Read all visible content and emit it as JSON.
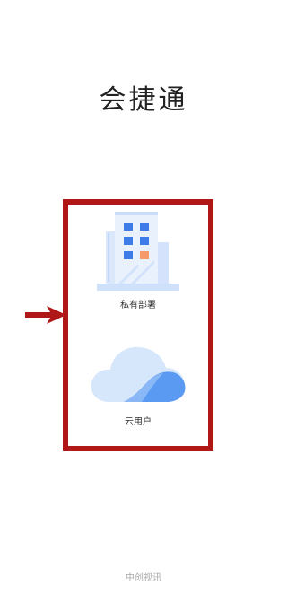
{
  "app": {
    "title": "会捷通"
  },
  "options": {
    "private": {
      "label": "私有部署",
      "icon": "office-building-icon"
    },
    "cloud": {
      "label": "云用户",
      "icon": "cloud-icon"
    }
  },
  "annotation": {
    "arrow_icon": "red-arrow-icon",
    "highlight_color": "#b01818"
  },
  "footer": {
    "text": "中创视讯"
  },
  "colors": {
    "building_blue": "#3d7be6",
    "building_light": "#cfe0fb",
    "window_orange": "#f59a6a",
    "cloud_light": "#d6e6fb",
    "cloud_blue": "#5a9af2"
  }
}
